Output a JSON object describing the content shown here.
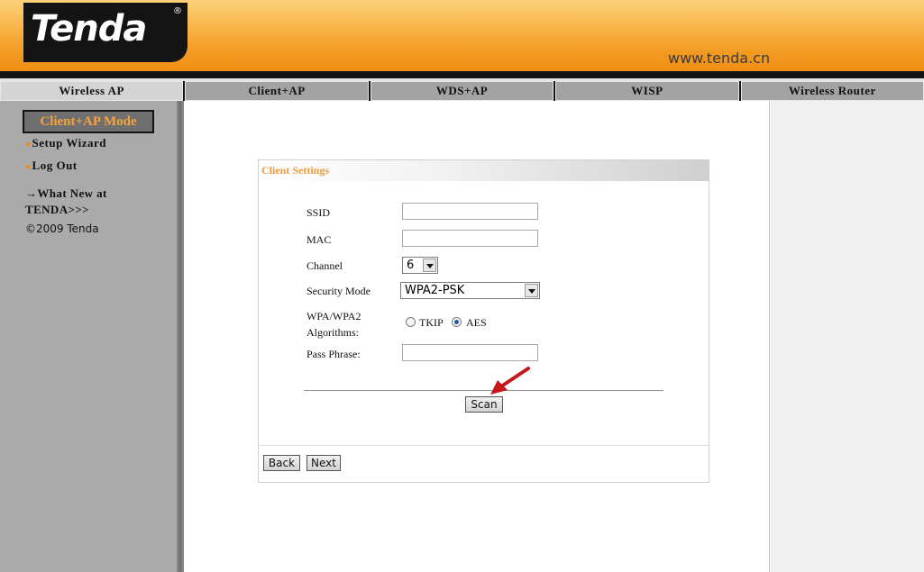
{
  "header": {
    "logo_text": "Tenda",
    "logo_mark": "®",
    "url": "www.tenda.cn"
  },
  "nav": {
    "tabs": [
      {
        "label": "Wireless AP",
        "active": true
      },
      {
        "label": "Client+AP",
        "active": false
      },
      {
        "label": "WDS+AP",
        "active": false
      },
      {
        "label": "WISP",
        "active": false
      },
      {
        "label": "Wireless Router",
        "active": false
      }
    ]
  },
  "sidebar": {
    "mode_label": "Client+AP Mode",
    "links": [
      "Setup Wizard",
      "Log Out"
    ],
    "whats_new_line1": "→What New at",
    "whats_new_line2": "TENDA>>>",
    "copyright": "©2009 Tenda"
  },
  "panel": {
    "title": "Client Settings",
    "ssid_label": "SSID",
    "ssid_value": "",
    "mac_label": "MAC",
    "mac_value": "",
    "channel_label": "Channel",
    "channel_value": "6",
    "security_label": "Security Mode",
    "security_value": "WPA2-PSK",
    "algorithms_label_line1": "WPA/WPA2",
    "algorithms_label_line2": "Algorithms:",
    "algorithm_options": [
      "TKIP",
      "AES"
    ],
    "algorithm_selected": "AES",
    "passphrase_label": "Pass Phrase:",
    "passphrase_value": "",
    "scan_label": "Scan",
    "back_label": "Back",
    "next_label": "Next"
  },
  "colors": {
    "accent_orange": "#f19a3a",
    "header_orange": "#ef8d14",
    "annotation_red": "#c8161d"
  }
}
